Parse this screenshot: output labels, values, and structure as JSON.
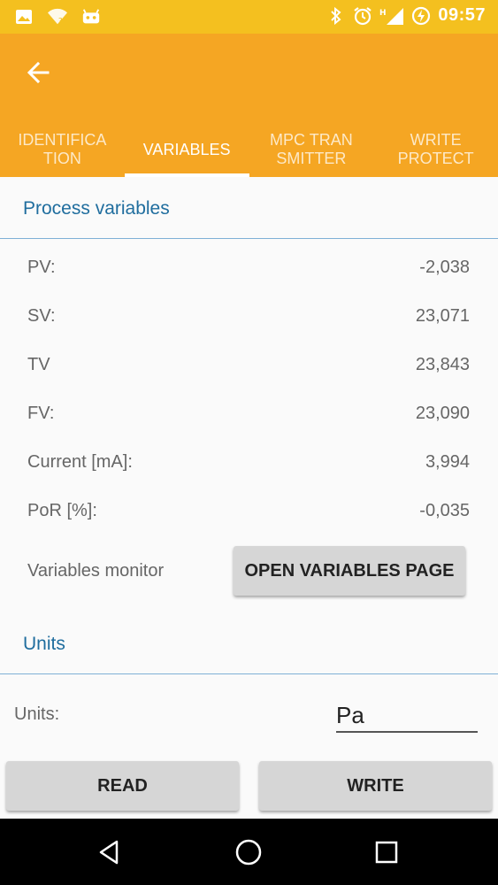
{
  "status_bar": {
    "time": "09:57",
    "left_icons": [
      "image-icon",
      "wifi-question-icon",
      "android-icon"
    ],
    "right_icons": [
      "bluetooth-icon",
      "alarm-icon",
      "signal-icon",
      "battery-charging-icon"
    ],
    "network_badge": "H"
  },
  "app_bar": {
    "tabs": [
      {
        "label": "IDENTIFICA\nTION",
        "active": false
      },
      {
        "label": "VARIABLES",
        "active": true
      },
      {
        "label": "MPC TRAN\nSMITTER",
        "active": false
      },
      {
        "label": "WRITE\nPROTECT",
        "active": false
      }
    ]
  },
  "process_variables": {
    "title": "Process variables",
    "rows": [
      {
        "label": "PV:",
        "value": "-2,038"
      },
      {
        "label": "SV:",
        "value": "23,071"
      },
      {
        "label": "TV",
        "value": "23,843"
      },
      {
        "label": "FV:",
        "value": "23,090"
      },
      {
        "label": "Current [mA]:",
        "value": "3,994"
      },
      {
        "label": "PoR [%]:",
        "value": "-0,035"
      }
    ],
    "monitor_label": "Variables monitor",
    "open_button": "OPEN VARIABLES PAGE"
  },
  "units_section": {
    "title": "Units",
    "label": "Units:",
    "value": "Pa"
  },
  "actions": {
    "read": "READ",
    "write": "WRITE"
  },
  "colors": {
    "status_bar": "#f4c01f",
    "app_bar": "#f5a623",
    "section_title": "#1f6d9e",
    "divider": "#7fb0d6"
  }
}
